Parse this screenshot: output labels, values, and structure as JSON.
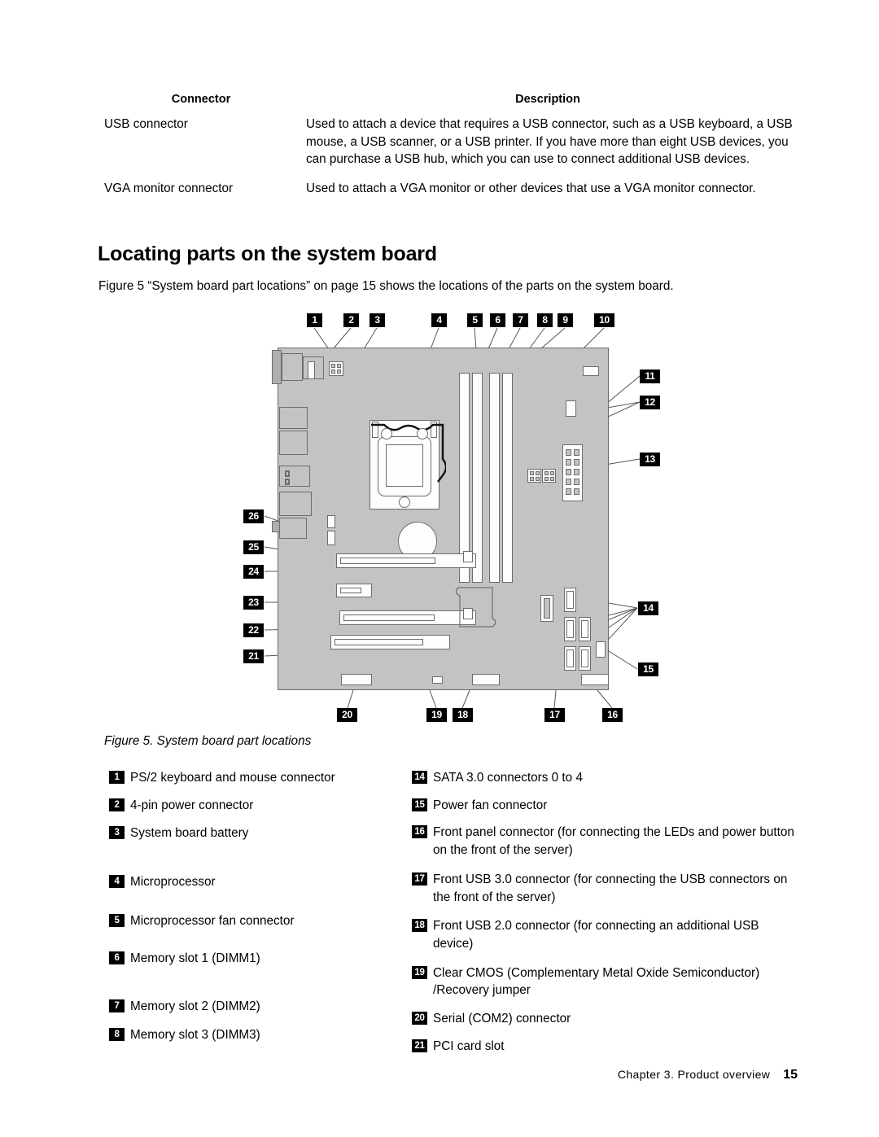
{
  "connector_table": {
    "headers": [
      "Connector",
      "Description"
    ],
    "rows": [
      {
        "connector": "USB connector",
        "description": "Used to attach a device that requires a USB connector, such as a USB keyboard, a USB mouse, a USB scanner, or a USB printer. If you have more than eight USB devices, you can purchase a USB hub, which you can use to connect additional USB devices."
      },
      {
        "connector": "VGA monitor connector",
        "description": "Used to attach a VGA monitor or other devices that use a VGA monitor connector."
      }
    ]
  },
  "section": {
    "heading": "Locating parts on the system board",
    "intro": "Figure 5 “System board part locations” on page 15 shows the locations of the parts on the system board."
  },
  "figure": {
    "caption": "Figure 5.  System board part locations",
    "callouts_top": [
      "1",
      "2",
      "3",
      "4",
      "5",
      "6",
      "7",
      "8",
      "9",
      "10"
    ],
    "callouts_right": [
      "11",
      "12",
      "13",
      "14",
      "15"
    ],
    "callouts_bottom": [
      "20",
      "19",
      "18",
      "17",
      "16"
    ],
    "callouts_left": [
      "26",
      "25",
      "24",
      "23",
      "22",
      "21"
    ]
  },
  "legend": {
    "left": [
      {
        "num": "1",
        "text": "PS/2 keyboard and mouse connector"
      },
      {
        "num": "2",
        "text": "4-pin power connector"
      },
      {
        "num": "3",
        "text": "System board battery"
      },
      {
        "num": "4",
        "text": "Microprocessor"
      },
      {
        "num": "5",
        "text": "Microprocessor fan connector"
      },
      {
        "num": "6",
        "text": "Memory slot 1 (DIMM1)"
      },
      {
        "num": "7",
        "text": "Memory slot 2 (DIMM2)"
      },
      {
        "num": "8",
        "text": "Memory slot 3 (DIMM3)"
      }
    ],
    "right": [
      {
        "num": "14",
        "text": "SATA 3.0 connectors 0 to 4"
      },
      {
        "num": "15",
        "text": "Power fan connector"
      },
      {
        "num": "16",
        "text": "Front panel connector (for connecting the LEDs and power button on the front of the server)"
      },
      {
        "num": "17",
        "text": "Front USB 3.0 connector (for connecting the USB connectors on the front of the server)"
      },
      {
        "num": "18",
        "text": "Front USB 2.0 connector (for connecting an additional USB device)"
      },
      {
        "num": "19",
        "text": "Clear CMOS (Complementary Metal Oxide Semiconductor) /Recovery jumper"
      },
      {
        "num": "20",
        "text": "Serial (COM2) connector"
      },
      {
        "num": "21",
        "text": "PCI card slot"
      }
    ]
  },
  "footer": {
    "chapter": "Chapter 3.  Product overview",
    "page": "15"
  }
}
